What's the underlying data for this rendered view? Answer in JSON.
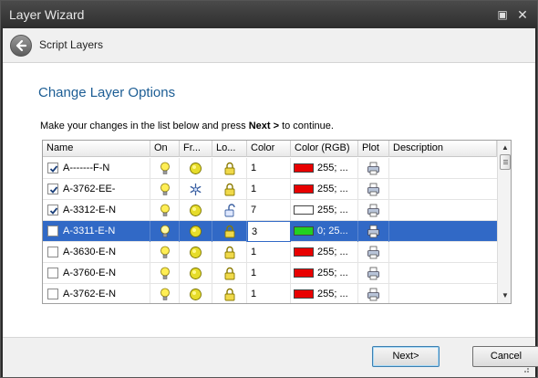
{
  "window": {
    "title": "Layer Wizard"
  },
  "header": {
    "breadcrumb": "Script Layers"
  },
  "main": {
    "heading": "Change Layer Options",
    "instruction_prefix": "Make your changes in the list below and press ",
    "instruction_bold": "Next >",
    "instruction_suffix": " to continue."
  },
  "table": {
    "columns": [
      "Name",
      "On",
      "Fr...",
      "Lo...",
      "Color",
      "Color (RGB)",
      "Plot",
      "Description"
    ],
    "rows": [
      {
        "checked": true,
        "name": "A-------F-N",
        "on": true,
        "frozen": false,
        "locked": true,
        "color": "1",
        "rgb": "255; ...",
        "swatch": "#e80000",
        "description": ""
      },
      {
        "checked": true,
        "name": "A-3762-EE-",
        "on": true,
        "frozen": true,
        "locked": true,
        "color": "1",
        "rgb": "255; ...",
        "swatch": "#e80000",
        "description": ""
      },
      {
        "checked": true,
        "name": "A-3312-E-N",
        "on": true,
        "frozen": false,
        "locked": false,
        "color": "7",
        "rgb": "255; ...",
        "swatch": "#ffffff",
        "description": ""
      },
      {
        "checked": false,
        "name": "A-3311-E-N",
        "on": true,
        "frozen": false,
        "locked": true,
        "color": "3",
        "rgb": "0; 25...",
        "swatch": "#22d022",
        "description": "",
        "selected": true
      },
      {
        "checked": false,
        "name": "A-3630-E-N",
        "on": true,
        "frozen": false,
        "locked": true,
        "color": "1",
        "rgb": "255; ...",
        "swatch": "#e80000",
        "description": ""
      },
      {
        "checked": false,
        "name": "A-3760-E-N",
        "on": true,
        "frozen": false,
        "locked": true,
        "color": "1",
        "rgb": "255; ...",
        "swatch": "#e80000",
        "description": ""
      },
      {
        "checked": false,
        "name": "A-3762-E-N",
        "on": true,
        "frozen": false,
        "locked": true,
        "color": "1",
        "rgb": "255; ...",
        "swatch": "#e80000",
        "description": ""
      }
    ]
  },
  "footer": {
    "next_label": "Next>",
    "cancel_label": "Cancel"
  }
}
